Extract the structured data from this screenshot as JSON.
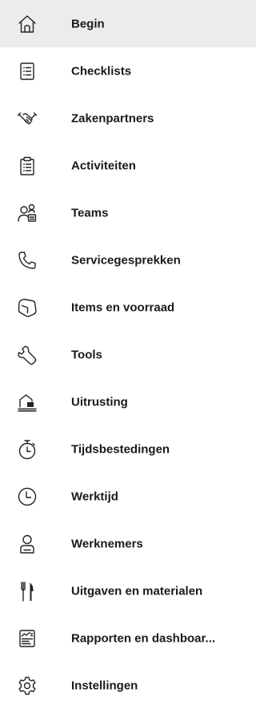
{
  "nav": {
    "items": [
      {
        "label": "Begin",
        "icon": "home-icon",
        "active": true
      },
      {
        "label": "Checklists",
        "icon": "checklist-icon"
      },
      {
        "label": "Zakenpartners",
        "icon": "handshake-icon"
      },
      {
        "label": "Activiteiten",
        "icon": "clipboard-icon"
      },
      {
        "label": "Teams",
        "icon": "people-team-icon"
      },
      {
        "label": "Servicegesprekken",
        "icon": "phone-icon"
      },
      {
        "label": "Items en voorraad",
        "icon": "box-icon"
      },
      {
        "label": "Tools",
        "icon": "wrench-icon"
      },
      {
        "label": "Uitrusting",
        "icon": "equipment-icon"
      },
      {
        "label": "Tijdsbestedingen",
        "icon": "stopwatch-icon"
      },
      {
        "label": "Werktijd",
        "icon": "clock-icon"
      },
      {
        "label": "Werknemers",
        "icon": "person-icon"
      },
      {
        "label": "Uitgaven en materialen",
        "icon": "fork-knife-icon"
      },
      {
        "label": "Rapporten en dashboar...",
        "icon": "report-icon"
      },
      {
        "label": "Instellingen",
        "icon": "gear-icon"
      }
    ]
  },
  "colors": {
    "active_background": "#ececec",
    "text": "#1a1a1a"
  }
}
